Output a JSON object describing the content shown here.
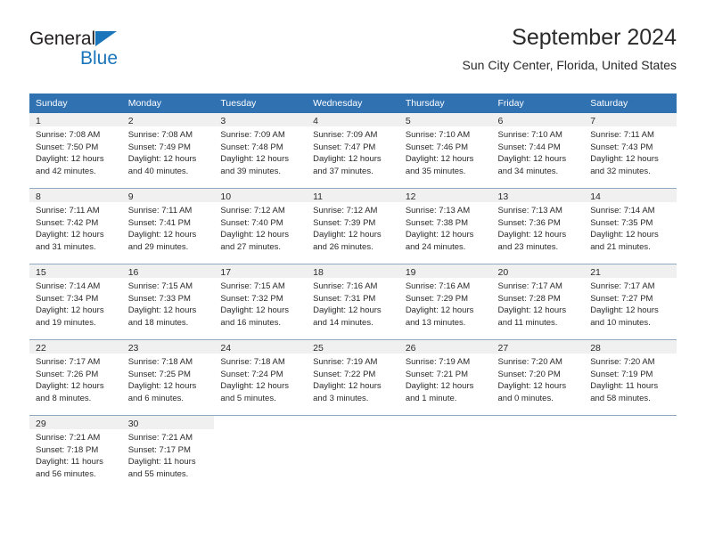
{
  "brand": {
    "name_part1": "General",
    "name_part2": "Blue"
  },
  "header": {
    "title": "September 2024",
    "subtitle": "Sun City Center, Florida, United States"
  },
  "colors": {
    "header_blue": "#3071b2",
    "brand_blue": "#1b75bb",
    "daynum_band": "#f0f0f0",
    "rule": "#8fa9c0",
    "text": "#2a2a2a"
  },
  "weekday_headers": [
    "Sunday",
    "Monday",
    "Tuesday",
    "Wednesday",
    "Thursday",
    "Friday",
    "Saturday"
  ],
  "weeks": [
    [
      {
        "day": "1",
        "sunrise": "Sunrise: 7:08 AM",
        "sunset": "Sunset: 7:50 PM",
        "daylight_line1": "Daylight: 12 hours",
        "daylight_line2": "and 42 minutes."
      },
      {
        "day": "2",
        "sunrise": "Sunrise: 7:08 AM",
        "sunset": "Sunset: 7:49 PM",
        "daylight_line1": "Daylight: 12 hours",
        "daylight_line2": "and 40 minutes."
      },
      {
        "day": "3",
        "sunrise": "Sunrise: 7:09 AM",
        "sunset": "Sunset: 7:48 PM",
        "daylight_line1": "Daylight: 12 hours",
        "daylight_line2": "and 39 minutes."
      },
      {
        "day": "4",
        "sunrise": "Sunrise: 7:09 AM",
        "sunset": "Sunset: 7:47 PM",
        "daylight_line1": "Daylight: 12 hours",
        "daylight_line2": "and 37 minutes."
      },
      {
        "day": "5",
        "sunrise": "Sunrise: 7:10 AM",
        "sunset": "Sunset: 7:46 PM",
        "daylight_line1": "Daylight: 12 hours",
        "daylight_line2": "and 35 minutes."
      },
      {
        "day": "6",
        "sunrise": "Sunrise: 7:10 AM",
        "sunset": "Sunset: 7:44 PM",
        "daylight_line1": "Daylight: 12 hours",
        "daylight_line2": "and 34 minutes."
      },
      {
        "day": "7",
        "sunrise": "Sunrise: 7:11 AM",
        "sunset": "Sunset: 7:43 PM",
        "daylight_line1": "Daylight: 12 hours",
        "daylight_line2": "and 32 minutes."
      }
    ],
    [
      {
        "day": "8",
        "sunrise": "Sunrise: 7:11 AM",
        "sunset": "Sunset: 7:42 PM",
        "daylight_line1": "Daylight: 12 hours",
        "daylight_line2": "and 31 minutes."
      },
      {
        "day": "9",
        "sunrise": "Sunrise: 7:11 AM",
        "sunset": "Sunset: 7:41 PM",
        "daylight_line1": "Daylight: 12 hours",
        "daylight_line2": "and 29 minutes."
      },
      {
        "day": "10",
        "sunrise": "Sunrise: 7:12 AM",
        "sunset": "Sunset: 7:40 PM",
        "daylight_line1": "Daylight: 12 hours",
        "daylight_line2": "and 27 minutes."
      },
      {
        "day": "11",
        "sunrise": "Sunrise: 7:12 AM",
        "sunset": "Sunset: 7:39 PM",
        "daylight_line1": "Daylight: 12 hours",
        "daylight_line2": "and 26 minutes."
      },
      {
        "day": "12",
        "sunrise": "Sunrise: 7:13 AM",
        "sunset": "Sunset: 7:38 PM",
        "daylight_line1": "Daylight: 12 hours",
        "daylight_line2": "and 24 minutes."
      },
      {
        "day": "13",
        "sunrise": "Sunrise: 7:13 AM",
        "sunset": "Sunset: 7:36 PM",
        "daylight_line1": "Daylight: 12 hours",
        "daylight_line2": "and 23 minutes."
      },
      {
        "day": "14",
        "sunrise": "Sunrise: 7:14 AM",
        "sunset": "Sunset: 7:35 PM",
        "daylight_line1": "Daylight: 12 hours",
        "daylight_line2": "and 21 minutes."
      }
    ],
    [
      {
        "day": "15",
        "sunrise": "Sunrise: 7:14 AM",
        "sunset": "Sunset: 7:34 PM",
        "daylight_line1": "Daylight: 12 hours",
        "daylight_line2": "and 19 minutes."
      },
      {
        "day": "16",
        "sunrise": "Sunrise: 7:15 AM",
        "sunset": "Sunset: 7:33 PM",
        "daylight_line1": "Daylight: 12 hours",
        "daylight_line2": "and 18 minutes."
      },
      {
        "day": "17",
        "sunrise": "Sunrise: 7:15 AM",
        "sunset": "Sunset: 7:32 PM",
        "daylight_line1": "Daylight: 12 hours",
        "daylight_line2": "and 16 minutes."
      },
      {
        "day": "18",
        "sunrise": "Sunrise: 7:16 AM",
        "sunset": "Sunset: 7:31 PM",
        "daylight_line1": "Daylight: 12 hours",
        "daylight_line2": "and 14 minutes."
      },
      {
        "day": "19",
        "sunrise": "Sunrise: 7:16 AM",
        "sunset": "Sunset: 7:29 PM",
        "daylight_line1": "Daylight: 12 hours",
        "daylight_line2": "and 13 minutes."
      },
      {
        "day": "20",
        "sunrise": "Sunrise: 7:17 AM",
        "sunset": "Sunset: 7:28 PM",
        "daylight_line1": "Daylight: 12 hours",
        "daylight_line2": "and 11 minutes."
      },
      {
        "day": "21",
        "sunrise": "Sunrise: 7:17 AM",
        "sunset": "Sunset: 7:27 PM",
        "daylight_line1": "Daylight: 12 hours",
        "daylight_line2": "and 10 minutes."
      }
    ],
    [
      {
        "day": "22",
        "sunrise": "Sunrise: 7:17 AM",
        "sunset": "Sunset: 7:26 PM",
        "daylight_line1": "Daylight: 12 hours",
        "daylight_line2": "and 8 minutes."
      },
      {
        "day": "23",
        "sunrise": "Sunrise: 7:18 AM",
        "sunset": "Sunset: 7:25 PM",
        "daylight_line1": "Daylight: 12 hours",
        "daylight_line2": "and 6 minutes."
      },
      {
        "day": "24",
        "sunrise": "Sunrise: 7:18 AM",
        "sunset": "Sunset: 7:24 PM",
        "daylight_line1": "Daylight: 12 hours",
        "daylight_line2": "and 5 minutes."
      },
      {
        "day": "25",
        "sunrise": "Sunrise: 7:19 AM",
        "sunset": "Sunset: 7:22 PM",
        "daylight_line1": "Daylight: 12 hours",
        "daylight_line2": "and 3 minutes."
      },
      {
        "day": "26",
        "sunrise": "Sunrise: 7:19 AM",
        "sunset": "Sunset: 7:21 PM",
        "daylight_line1": "Daylight: 12 hours",
        "daylight_line2": "and 1 minute."
      },
      {
        "day": "27",
        "sunrise": "Sunrise: 7:20 AM",
        "sunset": "Sunset: 7:20 PM",
        "daylight_line1": "Daylight: 12 hours",
        "daylight_line2": "and 0 minutes."
      },
      {
        "day": "28",
        "sunrise": "Sunrise: 7:20 AM",
        "sunset": "Sunset: 7:19 PM",
        "daylight_line1": "Daylight: 11 hours",
        "daylight_line2": "and 58 minutes."
      }
    ],
    [
      {
        "day": "29",
        "sunrise": "Sunrise: 7:21 AM",
        "sunset": "Sunset: 7:18 PM",
        "daylight_line1": "Daylight: 11 hours",
        "daylight_line2": "and 56 minutes."
      },
      {
        "day": "30",
        "sunrise": "Sunrise: 7:21 AM",
        "sunset": "Sunset: 7:17 PM",
        "daylight_line1": "Daylight: 11 hours",
        "daylight_line2": "and 55 minutes."
      },
      {
        "day": "",
        "sunrise": "",
        "sunset": "",
        "daylight_line1": "",
        "daylight_line2": ""
      },
      {
        "day": "",
        "sunrise": "",
        "sunset": "",
        "daylight_line1": "",
        "daylight_line2": ""
      },
      {
        "day": "",
        "sunrise": "",
        "sunset": "",
        "daylight_line1": "",
        "daylight_line2": ""
      },
      {
        "day": "",
        "sunrise": "",
        "sunset": "",
        "daylight_line1": "",
        "daylight_line2": ""
      },
      {
        "day": "",
        "sunrise": "",
        "sunset": "",
        "daylight_line1": "",
        "daylight_line2": ""
      }
    ]
  ]
}
